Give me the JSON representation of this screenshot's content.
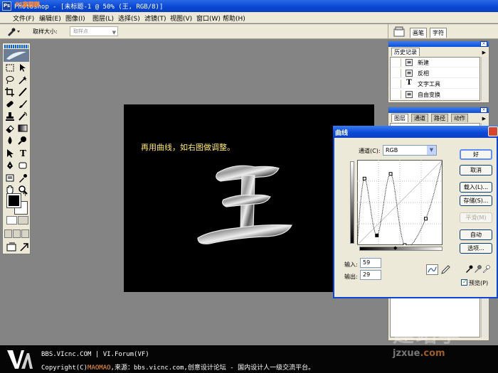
{
  "window": {
    "title": "Photoshop - [未标题-1 @ 50% (王, RGB/8)]",
    "watermark_top": "PS家园网"
  },
  "menu": [
    "文件(F)",
    "编辑(E)",
    "图像(I)",
    "图层(L)",
    "选择(S)",
    "滤镜(T)",
    "视图(V)",
    "窗口(W)",
    "帮助(H)"
  ],
  "options": {
    "sample_size_label": "取样大小:",
    "sample_size_value": "取样点",
    "palette_tabs": [
      "画笔",
      "字符"
    ]
  },
  "canvas": {
    "caption": "再用曲线，如右图做调整。",
    "glyph": "王"
  },
  "history": {
    "tab": "历史记录",
    "items": [
      {
        "icon": "document-icon",
        "label": "新建"
      },
      {
        "icon": "document-icon",
        "label": "反相"
      },
      {
        "icon": "text-tool-icon",
        "label": "文字工具"
      },
      {
        "icon": "document-icon",
        "label": "自由变换"
      }
    ]
  },
  "layers": {
    "tabs": [
      "图层",
      "通道",
      "路径",
      "动作"
    ]
  },
  "curves": {
    "title": "曲线",
    "channel_label": "通道(C):",
    "channel_value": "RGB",
    "input_label": "输入:",
    "input_value": "59",
    "output_label": "输出:",
    "output_value": "29",
    "buttons": {
      "ok": "好",
      "cancel": "取消",
      "load": "载入(L)...",
      "save": "存储(S)...",
      "smooth": "平滑(M)",
      "auto": "自动",
      "options": "选项..."
    },
    "preview_label": "预览(P)",
    "preview_checked": true,
    "curve_points": [
      [
        0,
        0
      ],
      [
        22,
        199
      ],
      [
        59,
        29
      ],
      [
        100,
        213
      ],
      [
        142,
        0
      ],
      [
        205,
        79
      ],
      [
        255,
        255
      ]
    ]
  },
  "banner": {
    "line1": "BBS.VIcnc.COM | VI.Forum(VF)",
    "line2_prefix": "Copyright(C)",
    "line2_author": "MAOMAO",
    "line2_rest": ",来源：bbs.vicnc.com,创意设计论坛 - 国内设计人一级交流平台。",
    "watermark_big": "建站学",
    "watermark_url": "jzxue",
    "watermark_tld": ".com"
  }
}
